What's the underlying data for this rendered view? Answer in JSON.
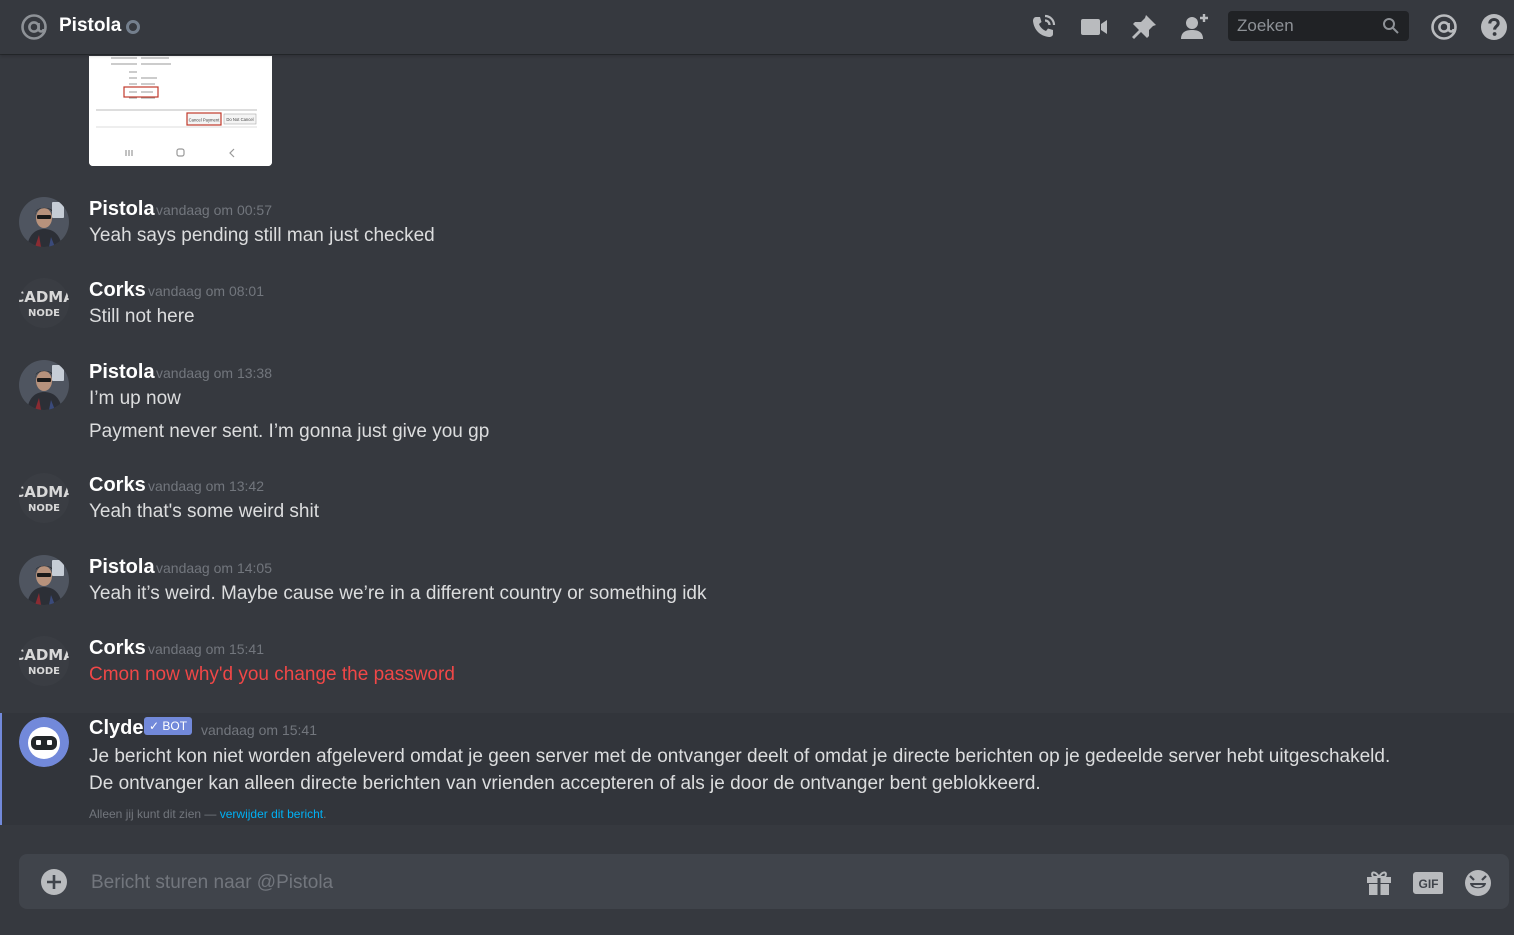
{
  "header": {
    "title": "Pistola",
    "search_placeholder": "Zoeken"
  },
  "messages": [
    {
      "author": "Pistola",
      "time": "vandaag om 00:57",
      "lines": [
        "Yeah says pending still man just checked"
      ]
    },
    {
      "author": "Corks",
      "time": "vandaag om 08:01",
      "lines": [
        "Still not here"
      ]
    },
    {
      "author": "Pistola",
      "time": "vandaag om 13:38",
      "lines": [
        "I’m up now",
        "Payment never sent. I’m gonna just give you gp"
      ]
    },
    {
      "author": "Corks",
      "time": "vandaag om 13:42",
      "lines": [
        "Yeah that's some weird shit"
      ]
    },
    {
      "author": "Pistola",
      "time": "vandaag om 14:05",
      "lines": [
        "Yeah it’s weird. Maybe cause we’re in a different country or something idk"
      ]
    },
    {
      "author": "Corks",
      "time": "vandaag om 15:41",
      "lines": [
        "Cmon now why'd you change the password"
      ]
    }
  ],
  "clyde": {
    "author": "Clyde",
    "badge": "BOT",
    "time": "vandaag om 15:41",
    "text": "Je bericht kon niet worden afgeleverd omdat je geen server met de ontvanger deelt of omdat je directe berichten op je gedeelde server hebt uitgeschakeld. De ontvanger kan alleen directe berichten van vrienden accepteren of als je door de ontvanger bent geblokkeerd.",
    "ephemeral_prefix": "Alleen jij kunt dit zien —",
    "ephemeral_link": "verwijder dit bericht",
    "ephemeral_suffix": "."
  },
  "composer": {
    "placeholder": "Bericht sturen naar @Pistola",
    "gif_label": "GIF"
  },
  "attachment": {
    "cancel_label": "Cancel Payment",
    "keep_label": "Do Not Cancel"
  },
  "avatar_text": {
    "top": "CADMA",
    "bottom": "NODE"
  },
  "colors": {
    "background": "#36393f",
    "accent": "#7289da",
    "error_text": "#f04747",
    "link": "#00b0f4"
  },
  "icons": [
    "at-icon",
    "status-icon",
    "voice-call-icon",
    "video-call-icon",
    "pin-icon",
    "add-friend-icon",
    "search-icon",
    "mention-icon",
    "help-icon",
    "plus-icon",
    "gift-icon",
    "gif-icon",
    "emoji-icon"
  ]
}
